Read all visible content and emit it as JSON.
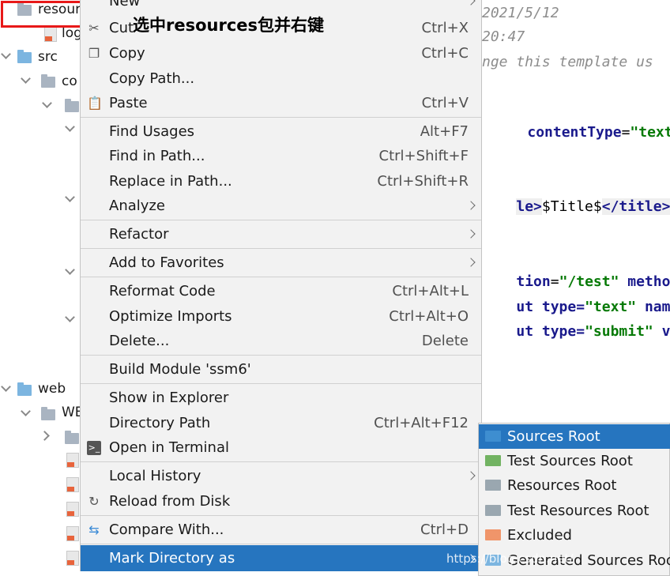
{
  "annotation": "选中resources包并右键",
  "tree": {
    "items": [
      {
        "label": "resour"
      },
      {
        "label": "log"
      },
      {
        "label": "src"
      },
      {
        "label": "co"
      },
      {
        "label": "web"
      },
      {
        "label": "WE"
      }
    ]
  },
  "editor": {
    "lines": {
      "date": "2021/5/12",
      "time": "20:47",
      "template": "nge this template us",
      "ct_attr": "contentType",
      "ct_eq": "=",
      "ct_val": "\"text/h",
      "title_open": "le>",
      "title_text": "$Title$",
      "title_close": "</title>",
      "action_attr": "tion",
      "action_eq": "=",
      "action_val": "\"/test\"",
      "method_attr": " method=",
      "ut1": "ut",
      "type1_attr": " type=",
      "type1_val": "\"text\"",
      "name_attr": " name=",
      "ut2": "ut",
      "type2_attr": " type=",
      "type2_val": "\"submit\"",
      "val_attr": " val"
    }
  },
  "menu": {
    "partial_top": "New",
    "items": {
      "cut": {
        "label": "Cut",
        "shortcut": "Ctrl+X",
        "icon": "scissors-icon"
      },
      "copy": {
        "label": "Copy",
        "shortcut": "Ctrl+C",
        "icon": "copy-icon"
      },
      "copy_path": {
        "label": "Copy Path..."
      },
      "paste": {
        "label": "Paste",
        "shortcut": "Ctrl+V",
        "icon": "paste-icon"
      },
      "find_usages": {
        "label": "Find Usages",
        "shortcut": "Alt+F7"
      },
      "find_in_path": {
        "label": "Find in Path...",
        "shortcut": "Ctrl+Shift+F"
      },
      "replace_in_path": {
        "label": "Replace in Path...",
        "shortcut": "Ctrl+Shift+R"
      },
      "analyze": {
        "label": "Analyze"
      },
      "refactor": {
        "label": "Refactor"
      },
      "add_to_favorites": {
        "label": "Add to Favorites"
      },
      "reformat_code": {
        "label": "Reformat Code",
        "shortcut": "Ctrl+Alt+L"
      },
      "optimize_imports": {
        "label": "Optimize Imports",
        "shortcut": "Ctrl+Alt+O"
      },
      "delete": {
        "label": "Delete...",
        "shortcut": "Delete"
      },
      "build_module": {
        "label": "Build Module 'ssm6'"
      },
      "show_in_explorer": {
        "label": "Show in Explorer"
      },
      "directory_path": {
        "label": "Directory Path",
        "shortcut": "Ctrl+Alt+F12"
      },
      "open_in_terminal": {
        "label": "Open in Terminal",
        "icon": "terminal-icon"
      },
      "local_history": {
        "label": "Local History"
      },
      "reload_from_disk": {
        "label": "Reload from Disk",
        "icon": "reload-icon"
      },
      "compare_with": {
        "label": "Compare With...",
        "shortcut": "Ctrl+D",
        "icon": "compare-icon"
      },
      "mark_directory_as": {
        "label": "Mark Directory as"
      }
    }
  },
  "submenu": {
    "items": [
      {
        "label": "Sources Root",
        "color": "#3e8ed0"
      },
      {
        "label": "Test Sources Root",
        "color": "#72b362"
      },
      {
        "label": "Resources Root",
        "color": "#9aa7b0"
      },
      {
        "label": "Test Resources Root",
        "color": "#9aa7b0"
      },
      {
        "label": "Excluded",
        "color": "#f0956a"
      },
      {
        "label": "Generated Sources Root",
        "color": "#7cb5e0"
      }
    ]
  },
  "watermark": "https://blog.csdn.net/"
}
